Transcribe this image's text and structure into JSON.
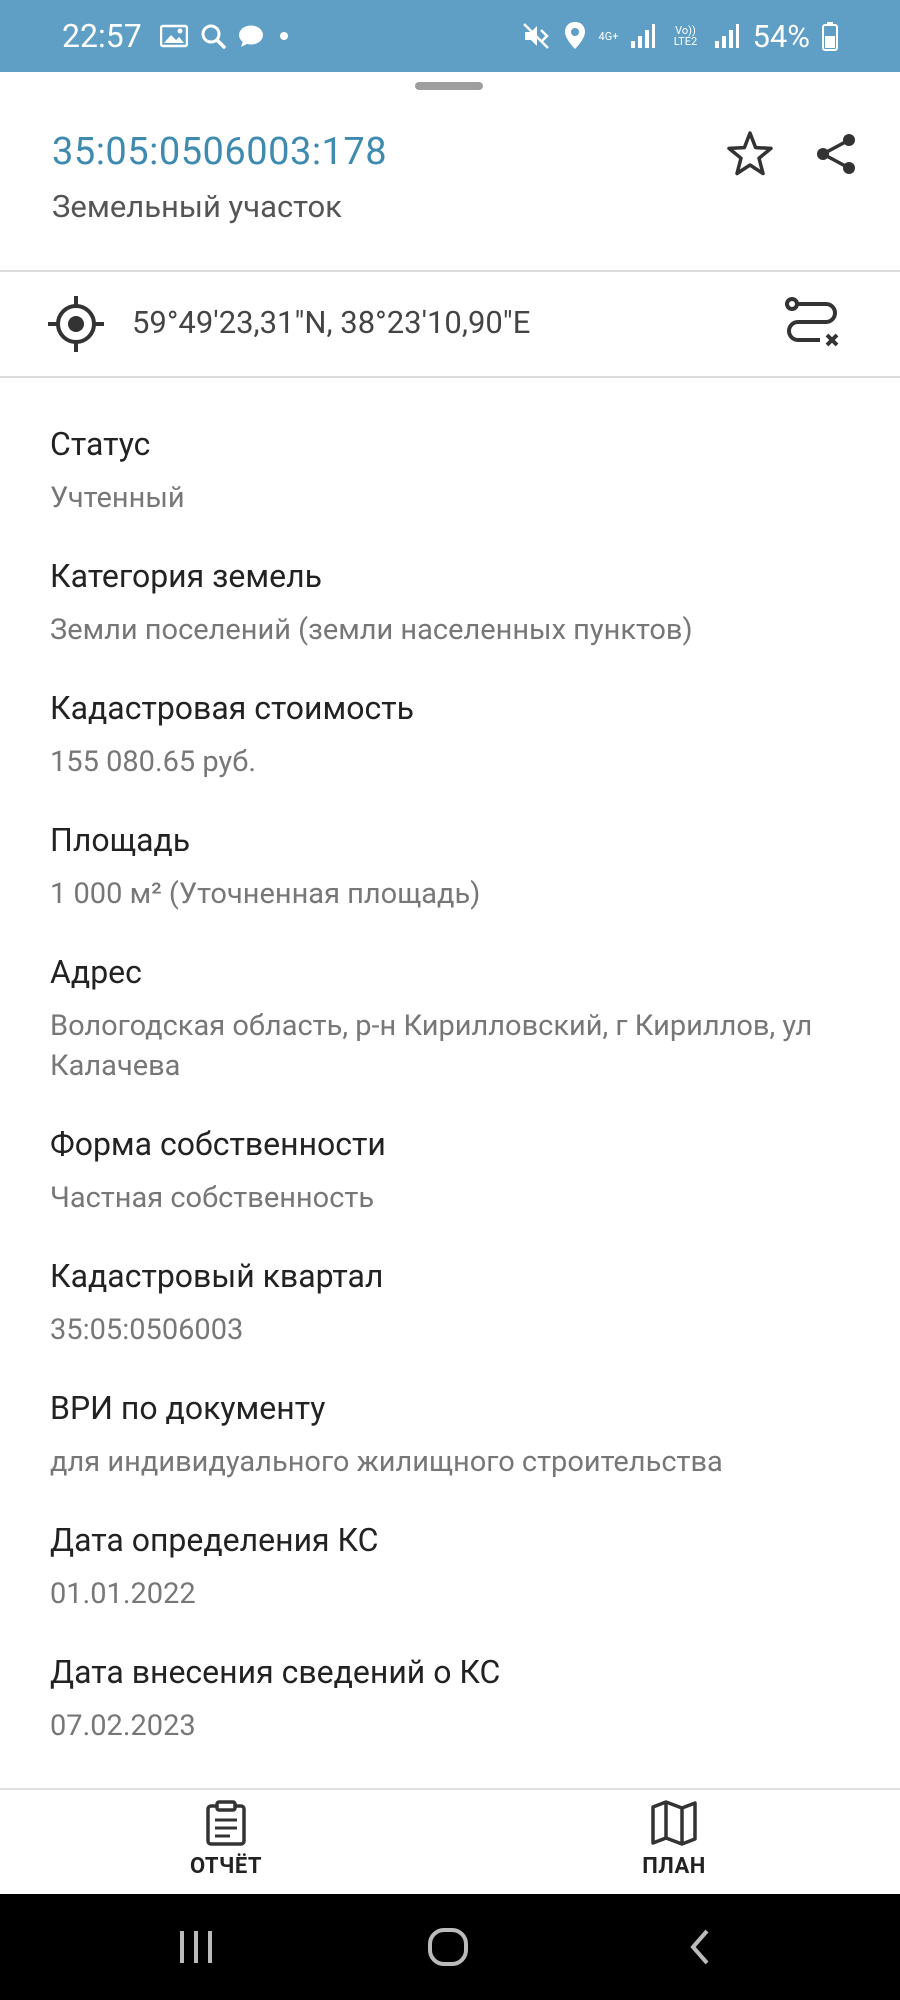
{
  "status_bar": {
    "time": "22:57",
    "battery": "54%",
    "network_4g": "4G+",
    "volte": "Vo)) LTE2",
    "left_icons": [
      "image-icon",
      "search-icon",
      "chat-icon",
      "dot-icon"
    ],
    "right_icons": [
      "mute-icon",
      "location-icon",
      "signal-icon",
      "signal-icon",
      "battery-icon"
    ]
  },
  "header": {
    "cadastral_number": "35:05:0506003:178",
    "object_type": "Земельный участок",
    "icons": [
      "star-icon",
      "share-icon"
    ]
  },
  "coordinates": {
    "text": "59°49'23,31\"N, 38°23'10,90\"E",
    "icons": [
      "target-icon",
      "route-icon"
    ]
  },
  "attributes": [
    {
      "label": "Статус",
      "value": "Учтенный"
    },
    {
      "label": "Категория земель",
      "value": "Земли поселений (земли населенных пунктов)"
    },
    {
      "label": "Кадастровая стоимость",
      "value": "155 080.65 руб."
    },
    {
      "label": "Площадь",
      "value": "1 000 м² (Уточненная площадь)"
    },
    {
      "label": "Адрес",
      "value": "Вологодская область, р-н Кирилловский, г Кириллов, ул Калачева"
    },
    {
      "label": "Форма собственности",
      "value": "Частная собственность"
    },
    {
      "label": "Кадастровый квартал",
      "value": "35:05:0506003"
    },
    {
      "label": "ВРИ по документу",
      "value": "для индивидуального жилищного строительства"
    },
    {
      "label": "Дата определения КС",
      "value": "01.01.2022"
    },
    {
      "label": "Дата внесения сведений о КС",
      "value": "07.02.2023"
    }
  ],
  "actions": {
    "report_label": "ОТЧЁТ",
    "plan_label": "ПЛАН"
  },
  "colors": {
    "status_bar": "#5f9fc6",
    "accent": "#3f8bb0"
  }
}
